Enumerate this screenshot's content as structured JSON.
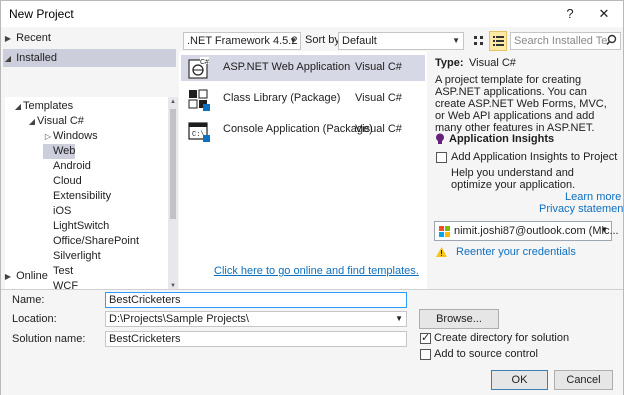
{
  "window": {
    "title": "New Project",
    "help": "?",
    "close": "✕"
  },
  "left": {
    "recent": "Recent",
    "installed": "Installed",
    "online": "Online",
    "tree": [
      {
        "label": "Templates",
        "indent": 0,
        "arrow": "◢"
      },
      {
        "label": "Visual C#",
        "indent": 1,
        "arrow": "◢"
      },
      {
        "label": "Windows",
        "indent": 2,
        "arrow": "▷"
      },
      {
        "label": "Web",
        "indent": 2,
        "arrow": ""
      },
      {
        "label": "Android",
        "indent": 2,
        "arrow": ""
      },
      {
        "label": "Cloud",
        "indent": 2,
        "arrow": ""
      },
      {
        "label": "Extensibility",
        "indent": 2,
        "arrow": ""
      },
      {
        "label": "iOS",
        "indent": 2,
        "arrow": ""
      },
      {
        "label": "LightSwitch",
        "indent": 2,
        "arrow": ""
      },
      {
        "label": "Office/SharePoint",
        "indent": 2,
        "arrow": ""
      },
      {
        "label": "Silverlight",
        "indent": 2,
        "arrow": ""
      },
      {
        "label": "Test",
        "indent": 2,
        "arrow": ""
      },
      {
        "label": "WCF",
        "indent": 2,
        "arrow": ""
      }
    ],
    "selected": "Web"
  },
  "toolbar": {
    "framework": ".NET Framework 4.5.2",
    "sort_label": "Sort by:",
    "sort_value": "Default",
    "search_placeholder": "Search Installed Te",
    "search_icon": "search-icon"
  },
  "templates": [
    {
      "name": "ASP.NET Web Application",
      "lang": "Visual C#",
      "icon": "aspnet-icon"
    },
    {
      "name": "Class Library (Package)",
      "lang": "Visual C#",
      "icon": "class-library-icon"
    },
    {
      "name": "Console Application (Package)",
      "lang": "Visual C#",
      "icon": "console-app-icon"
    }
  ],
  "online_link": "Click here to go online and find templates.",
  "details": {
    "type_label": "Type:",
    "type_value": "Visual C#",
    "description": "A project template for creating ASP.NET applications. You can create ASP.NET Web Forms, MVC,  or Web API applications and add many other features in ASP.NET.",
    "insights_title": "Application Insights",
    "insights_checkbox": "Add Application Insights to Project",
    "insights_help": "Help you understand and optimize your application.",
    "learn_more": "Learn more",
    "privacy": "Privacy statement",
    "account": "nimit.joshi87@outlook.com (Mic...",
    "reenter": "Reenter your credentials"
  },
  "form": {
    "name_label": "Name:",
    "name_value": "BestCricketers",
    "location_label": "Location:",
    "location_value": "D:\\Projects\\Sample Projects\\",
    "solution_label": "Solution name:",
    "solution_value": "BestCricketers",
    "browse": "Browse...",
    "create_dir": "Create directory for solution",
    "source_control": "Add to source control",
    "ok": "OK",
    "cancel": "Cancel"
  },
  "colors": {
    "selection": "#cccedb",
    "link": "#0e70c0",
    "accent": "#68217a"
  }
}
